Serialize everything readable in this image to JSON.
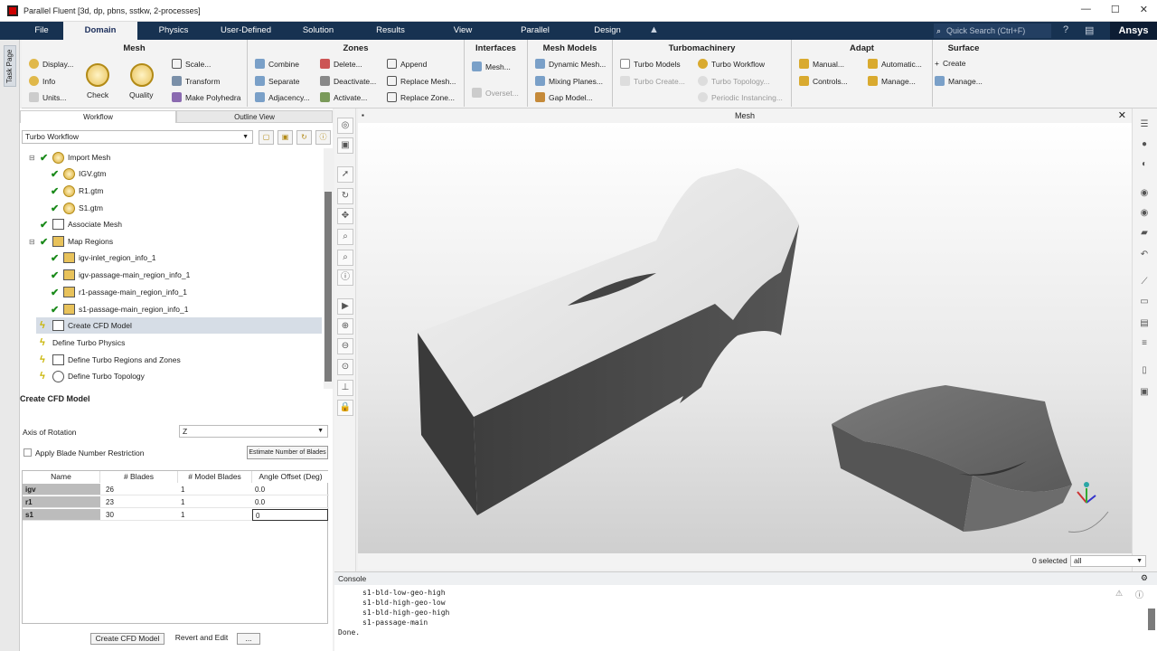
{
  "window": {
    "title": "Parallel Fluent [3d, dp, pbns, sstkw, 2-processes]"
  },
  "menu": {
    "tabs": [
      "File",
      "Domain",
      "Physics",
      "User-Defined",
      "Solution",
      "Results",
      "View",
      "Parallel",
      "Design"
    ],
    "active": "Domain",
    "search_placeholder": "Quick Search (Ctrl+F)",
    "brand": "Ansys"
  },
  "ribbon": {
    "mesh": {
      "title": "Mesh",
      "display": "Display...",
      "info": "Info",
      "units": "Units...",
      "check": "Check",
      "quality": "Quality",
      "scale": "Scale...",
      "transform": "Transform",
      "make_polyhedra": "Make Polyhedra"
    },
    "zones": {
      "title": "Zones",
      "combine": "Combine",
      "separate": "Separate",
      "adjacency": "Adjacency...",
      "delete": "Delete...",
      "deactivate": "Deactivate...",
      "activate": "Activate...",
      "append": "Append",
      "replace_mesh": "Replace Mesh...",
      "replace_zone": "Replace Zone..."
    },
    "interfaces": {
      "title": "Interfaces",
      "mesh": "Mesh...",
      "overset": "Overset..."
    },
    "mesh_models": {
      "title": "Mesh Models",
      "dynamic_mesh": "Dynamic Mesh...",
      "mixing_planes": "Mixing Planes...",
      "gap_model": "Gap Model..."
    },
    "turbomachinery": {
      "title": "Turbomachinery",
      "turbo_models": "Turbo Models",
      "turbo_workflow": "Turbo Workflow",
      "turbo_create": "Turbo Create...",
      "turbo_topology": "Turbo Topology...",
      "periodic_instancing": "Periodic Instancing..."
    },
    "adapt": {
      "title": "Adapt",
      "manual": "Manual...",
      "automatic": "Automatic...",
      "controls": "Controls...",
      "manage": "Manage..."
    },
    "surface": {
      "title": "Surface",
      "create": "Create",
      "manage": "Manage..."
    }
  },
  "task_page_label": "Task Page",
  "left_tabs": [
    "Workflow",
    "Outline View"
  ],
  "workflow_select": "Turbo Workflow",
  "tree": [
    "Import Mesh",
    "IGV.gtm",
    "R1.gtm",
    "S1.gtm",
    "Associate Mesh",
    "Map Regions",
    "igv-inlet_region_info_1",
    "igv-passage-main_region_info_1",
    "r1-passage-main_region_info_1",
    "s1-passage-main_region_info_1",
    "Create CFD Model",
    "Define Turbo Physics",
    "Define Turbo Regions and Zones",
    "Define Turbo Topology"
  ],
  "cfd": {
    "title": "Create CFD Model",
    "axis_label": "Axis of Rotation",
    "axis_value": "Z",
    "restrict_label": "Apply Blade Number Restriction",
    "estimate_btn": "Estimate Number of Blades",
    "columns": [
      "Name",
      "# Blades",
      "# Model Blades",
      "Angle Offset (Deg)"
    ],
    "rows": [
      [
        "igv",
        "26",
        "1",
        "0.0"
      ],
      [
        "r1",
        "23",
        "1",
        "0.0"
      ],
      [
        "s1",
        "30",
        "1",
        "0"
      ]
    ],
    "create_btn": "Create CFD Model",
    "revert_btn": "Revert and Edit",
    "more_btn": "..."
  },
  "graphics": {
    "title": "Mesh",
    "selected": "0 selected",
    "filter": "all"
  },
  "console": {
    "title": "Console",
    "lines": [
      "s1-bld-low-geo-high",
      "s1-bld-high-geo-low",
      "s1-bld-high-geo-high",
      "s1-passage-main",
      "Done."
    ]
  }
}
